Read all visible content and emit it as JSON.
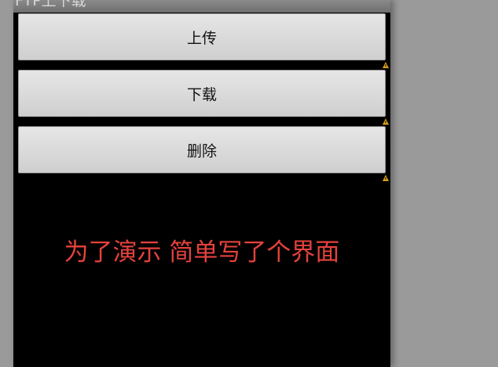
{
  "window": {
    "title": "FTP上下载"
  },
  "buttons": {
    "upload": "上传",
    "download": "下载",
    "delete": "删除"
  },
  "message": "为了演示  简单写了个界面",
  "colors": {
    "background": "#000000",
    "button": "#d9d9d9",
    "message_text": "#e4423c",
    "warning_icon": "#d4a017"
  },
  "icons": [
    "warning-icon",
    "warning-icon",
    "warning-icon"
  ]
}
